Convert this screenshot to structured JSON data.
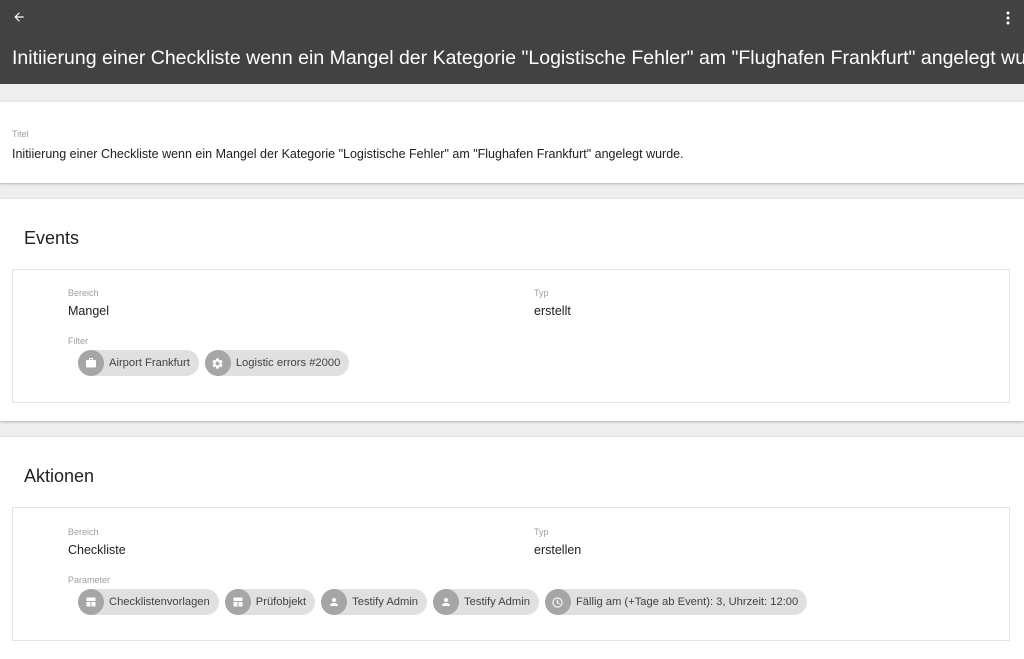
{
  "appbar": {
    "title": "Initiierung einer Checkliste wenn ein Mangel der Kategorie \"Logistische Fehler\" am \"Flughafen Frankfurt\" angelegt wurde.",
    "back_icon": "arrow-back-icon",
    "menu_icon": "more-vert-icon",
    "background": "#424242"
  },
  "title_card": {
    "label": "Titel",
    "value": "Initiierung einer Checkliste wenn ein Mangel der Kategorie \"Logistische Fehler\" am \"Flughafen Frankfurt\" angelegt wurde."
  },
  "events": {
    "heading": "Events",
    "bereich_label": "Bereich",
    "bereich_value": "Mangel",
    "typ_label": "Typ",
    "typ_value": "erstellt",
    "filter_label": "Filter",
    "chips": [
      {
        "label": "Airport Frankfurt",
        "icon": "briefcase-icon"
      },
      {
        "label": "Logistic errors #2000",
        "icon": "gear-icon"
      }
    ]
  },
  "actions": {
    "heading": "Aktionen",
    "bereich_label": "Bereich",
    "bereich_value": "Checkliste",
    "typ_label": "Typ",
    "typ_value": "erstellen",
    "parameter_label": "Parameter",
    "chips": [
      {
        "label": "Checklistenvorlagen",
        "icon": "template-icon"
      },
      {
        "label": "Prüfobjekt",
        "icon": "template-icon"
      },
      {
        "label": "Testify Admin",
        "icon": "person-icon"
      },
      {
        "label": "Testify Admin",
        "icon": "person-icon"
      },
      {
        "label": "Fällig am (+Tage ab Event): 3, Uhrzeit: 12:00",
        "icon": "clock-icon"
      }
    ]
  }
}
